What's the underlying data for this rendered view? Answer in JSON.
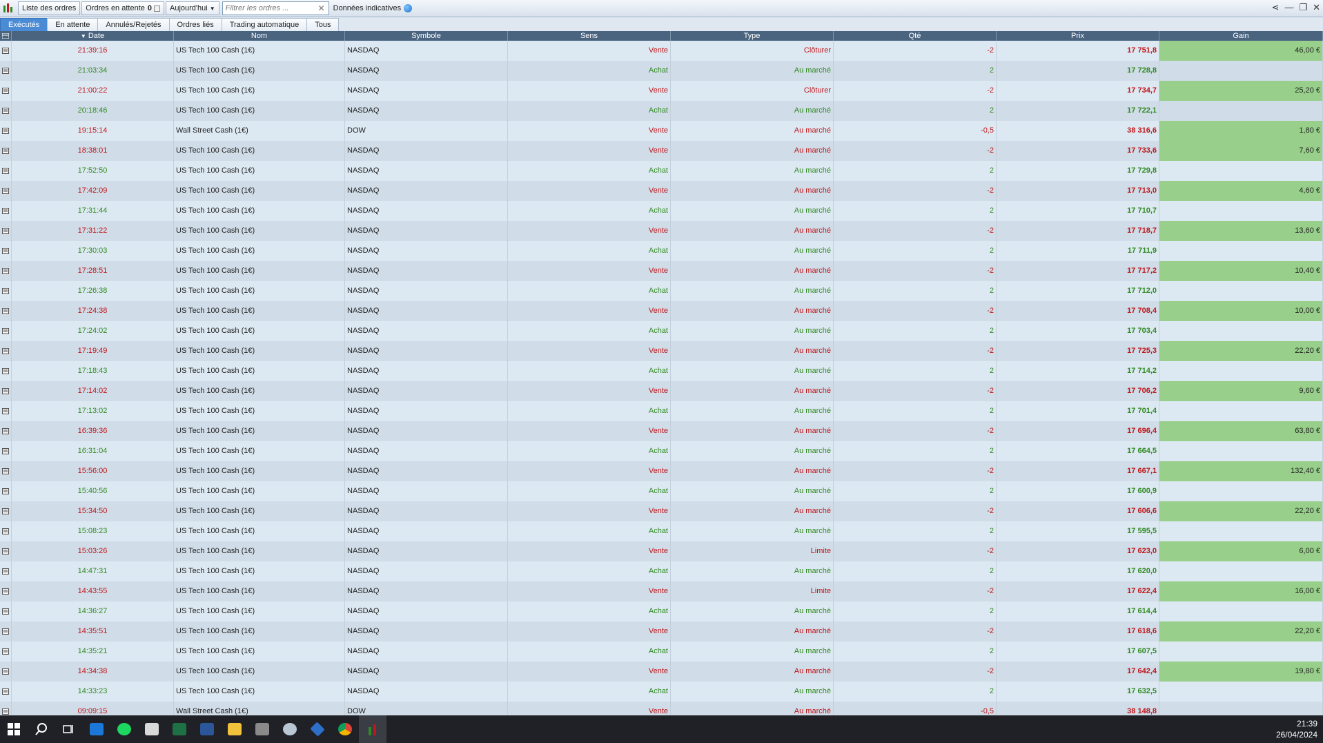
{
  "toolbar": {
    "orders_list": "Liste des ordres",
    "pending_orders": "Ordres en attente",
    "pending_count": "0",
    "period": "Aujourd'hui",
    "filter_placeholder": "Filtrer les ordres ...",
    "data_indicative": "Données indicatives"
  },
  "tabs": [
    "Exécutés",
    "En attente",
    "Annulés/Rejetés",
    "Ordres liés",
    "Trading automatique",
    "Tous"
  ],
  "columns": {
    "date": "Date",
    "nom": "Nom",
    "symbole": "Symbole",
    "sens": "Sens",
    "type": "Type",
    "qte": "Qté",
    "prix": "Prix",
    "gain": "Gain"
  },
  "colors": {
    "sell": "#c0161b",
    "buy": "#2f8a22",
    "gain_bg": "#98cf8a",
    "header": "#4a6480"
  },
  "rows": [
    {
      "time": "21:39:16",
      "nom": "US Tech 100 Cash (1€)",
      "sym": "NASDAQ",
      "sens": "Vente",
      "type": "Clôturer",
      "qte": "-2",
      "prix": "17 751,8",
      "gain": "46,00 €"
    },
    {
      "time": "21:03:34",
      "nom": "US Tech 100 Cash (1€)",
      "sym": "NASDAQ",
      "sens": "Achat",
      "type": "Au marché",
      "qte": "2",
      "prix": "17 728,8",
      "gain": ""
    },
    {
      "time": "21:00:22",
      "nom": "US Tech 100 Cash (1€)",
      "sym": "NASDAQ",
      "sens": "Vente",
      "type": "Clôturer",
      "qte": "-2",
      "prix": "17 734,7",
      "gain": "25,20 €"
    },
    {
      "time": "20:18:46",
      "nom": "US Tech 100 Cash (1€)",
      "sym": "NASDAQ",
      "sens": "Achat",
      "type": "Au marché",
      "qte": "2",
      "prix": "17 722,1",
      "gain": ""
    },
    {
      "time": "19:15:14",
      "nom": "Wall Street Cash (1€)",
      "sym": "DOW",
      "sens": "Vente",
      "type": "Au marché",
      "qte": "-0,5",
      "prix": "38 316,6",
      "gain": "1,80 €"
    },
    {
      "time": "18:38:01",
      "nom": "US Tech 100 Cash (1€)",
      "sym": "NASDAQ",
      "sens": "Vente",
      "type": "Au marché",
      "qte": "-2",
      "prix": "17 733,6",
      "gain": "7,60 €"
    },
    {
      "time": "17:52:50",
      "nom": "US Tech 100 Cash (1€)",
      "sym": "NASDAQ",
      "sens": "Achat",
      "type": "Au marché",
      "qte": "2",
      "prix": "17 729,8",
      "gain": ""
    },
    {
      "time": "17:42:09",
      "nom": "US Tech 100 Cash (1€)",
      "sym": "NASDAQ",
      "sens": "Vente",
      "type": "Au marché",
      "qte": "-2",
      "prix": "17 713,0",
      "gain": "4,60 €"
    },
    {
      "time": "17:31:44",
      "nom": "US Tech 100 Cash (1€)",
      "sym": "NASDAQ",
      "sens": "Achat",
      "type": "Au marché",
      "qte": "2",
      "prix": "17 710,7",
      "gain": ""
    },
    {
      "time": "17:31:22",
      "nom": "US Tech 100 Cash (1€)",
      "sym": "NASDAQ",
      "sens": "Vente",
      "type": "Au marché",
      "qte": "-2",
      "prix": "17 718,7",
      "gain": "13,60 €"
    },
    {
      "time": "17:30:03",
      "nom": "US Tech 100 Cash (1€)",
      "sym": "NASDAQ",
      "sens": "Achat",
      "type": "Au marché",
      "qte": "2",
      "prix": "17 711,9",
      "gain": ""
    },
    {
      "time": "17:28:51",
      "nom": "US Tech 100 Cash (1€)",
      "sym": "NASDAQ",
      "sens": "Vente",
      "type": "Au marché",
      "qte": "-2",
      "prix": "17 717,2",
      "gain": "10,40 €"
    },
    {
      "time": "17:26:38",
      "nom": "US Tech 100 Cash (1€)",
      "sym": "NASDAQ",
      "sens": "Achat",
      "type": "Au marché",
      "qte": "2",
      "prix": "17 712,0",
      "gain": ""
    },
    {
      "time": "17:24:38",
      "nom": "US Tech 100 Cash (1€)",
      "sym": "NASDAQ",
      "sens": "Vente",
      "type": "Au marché",
      "qte": "-2",
      "prix": "17 708,4",
      "gain": "10,00 €"
    },
    {
      "time": "17:24:02",
      "nom": "US Tech 100 Cash (1€)",
      "sym": "NASDAQ",
      "sens": "Achat",
      "type": "Au marché",
      "qte": "2",
      "prix": "17 703,4",
      "gain": ""
    },
    {
      "time": "17:19:49",
      "nom": "US Tech 100 Cash (1€)",
      "sym": "NASDAQ",
      "sens": "Vente",
      "type": "Au marché",
      "qte": "-2",
      "prix": "17 725,3",
      "gain": "22,20 €"
    },
    {
      "time": "17:18:43",
      "nom": "US Tech 100 Cash (1€)",
      "sym": "NASDAQ",
      "sens": "Achat",
      "type": "Au marché",
      "qte": "2",
      "prix": "17 714,2",
      "gain": ""
    },
    {
      "time": "17:14:02",
      "nom": "US Tech 100 Cash (1€)",
      "sym": "NASDAQ",
      "sens": "Vente",
      "type": "Au marché",
      "qte": "-2",
      "prix": "17 706,2",
      "gain": "9,60 €"
    },
    {
      "time": "17:13:02",
      "nom": "US Tech 100 Cash (1€)",
      "sym": "NASDAQ",
      "sens": "Achat",
      "type": "Au marché",
      "qte": "2",
      "prix": "17 701,4",
      "gain": ""
    },
    {
      "time": "16:39:36",
      "nom": "US Tech 100 Cash (1€)",
      "sym": "NASDAQ",
      "sens": "Vente",
      "type": "Au marché",
      "qte": "-2",
      "prix": "17 696,4",
      "gain": "63,80 €"
    },
    {
      "time": "16:31:04",
      "nom": "US Tech 100 Cash (1€)",
      "sym": "NASDAQ",
      "sens": "Achat",
      "type": "Au marché",
      "qte": "2",
      "prix": "17 664,5",
      "gain": ""
    },
    {
      "time": "15:56:00",
      "nom": "US Tech 100 Cash (1€)",
      "sym": "NASDAQ",
      "sens": "Vente",
      "type": "Au marché",
      "qte": "-2",
      "prix": "17 667,1",
      "gain": "132,40 €"
    },
    {
      "time": "15:40:56",
      "nom": "US Tech 100 Cash (1€)",
      "sym": "NASDAQ",
      "sens": "Achat",
      "type": "Au marché",
      "qte": "2",
      "prix": "17 600,9",
      "gain": ""
    },
    {
      "time": "15:34:50",
      "nom": "US Tech 100 Cash (1€)",
      "sym": "NASDAQ",
      "sens": "Vente",
      "type": "Au marché",
      "qte": "-2",
      "prix": "17 606,6",
      "gain": "22,20 €"
    },
    {
      "time": "15:08:23",
      "nom": "US Tech 100 Cash (1€)",
      "sym": "NASDAQ",
      "sens": "Achat",
      "type": "Au marché",
      "qte": "2",
      "prix": "17 595,5",
      "gain": ""
    },
    {
      "time": "15:03:26",
      "nom": "US Tech 100 Cash (1€)",
      "sym": "NASDAQ",
      "sens": "Vente",
      "type": "Limite",
      "qte": "-2",
      "prix": "17 623,0",
      "gain": "6,00 €"
    },
    {
      "time": "14:47:31",
      "nom": "US Tech 100 Cash (1€)",
      "sym": "NASDAQ",
      "sens": "Achat",
      "type": "Au marché",
      "qte": "2",
      "prix": "17 620,0",
      "gain": ""
    },
    {
      "time": "14:43:55",
      "nom": "US Tech 100 Cash (1€)",
      "sym": "NASDAQ",
      "sens": "Vente",
      "type": "Limite",
      "qte": "-2",
      "prix": "17 622,4",
      "gain": "16,00 €"
    },
    {
      "time": "14:36:27",
      "nom": "US Tech 100 Cash (1€)",
      "sym": "NASDAQ",
      "sens": "Achat",
      "type": "Au marché",
      "qte": "2",
      "prix": "17 614,4",
      "gain": ""
    },
    {
      "time": "14:35:51",
      "nom": "US Tech 100 Cash (1€)",
      "sym": "NASDAQ",
      "sens": "Vente",
      "type": "Au marché",
      "qte": "-2",
      "prix": "17 618,6",
      "gain": "22,20 €"
    },
    {
      "time": "14:35:21",
      "nom": "US Tech 100 Cash (1€)",
      "sym": "NASDAQ",
      "sens": "Achat",
      "type": "Au marché",
      "qte": "2",
      "prix": "17 607,5",
      "gain": ""
    },
    {
      "time": "14:34:38",
      "nom": "US Tech 100 Cash (1€)",
      "sym": "NASDAQ",
      "sens": "Vente",
      "type": "Au marché",
      "qte": "-2",
      "prix": "17 642,4",
      "gain": "19,80 €"
    },
    {
      "time": "14:33:23",
      "nom": "US Tech 100 Cash (1€)",
      "sym": "NASDAQ",
      "sens": "Achat",
      "type": "Au marché",
      "qte": "2",
      "prix": "17 632,5",
      "gain": ""
    },
    {
      "time": "09:09:15",
      "nom": "Wall Street Cash (1€)",
      "sym": "DOW",
      "sens": "Vente",
      "type": "Au marché",
      "qte": "-0,5",
      "prix": "38 148,8",
      "gain": ""
    }
  ],
  "taskbar": {
    "icons": [
      "windows-start-icon",
      "search-icon",
      "task-view-icon",
      "app-blue-icon",
      "spotify-icon",
      "files-icon",
      "excel-icon",
      "word-icon",
      "file-explorer-icon",
      "calculator-icon",
      "settings-app-icon",
      "app-diamond-icon",
      "chrome-icon",
      "trading-app-icon"
    ],
    "time": "21:39",
    "date": "26/04/2024"
  }
}
